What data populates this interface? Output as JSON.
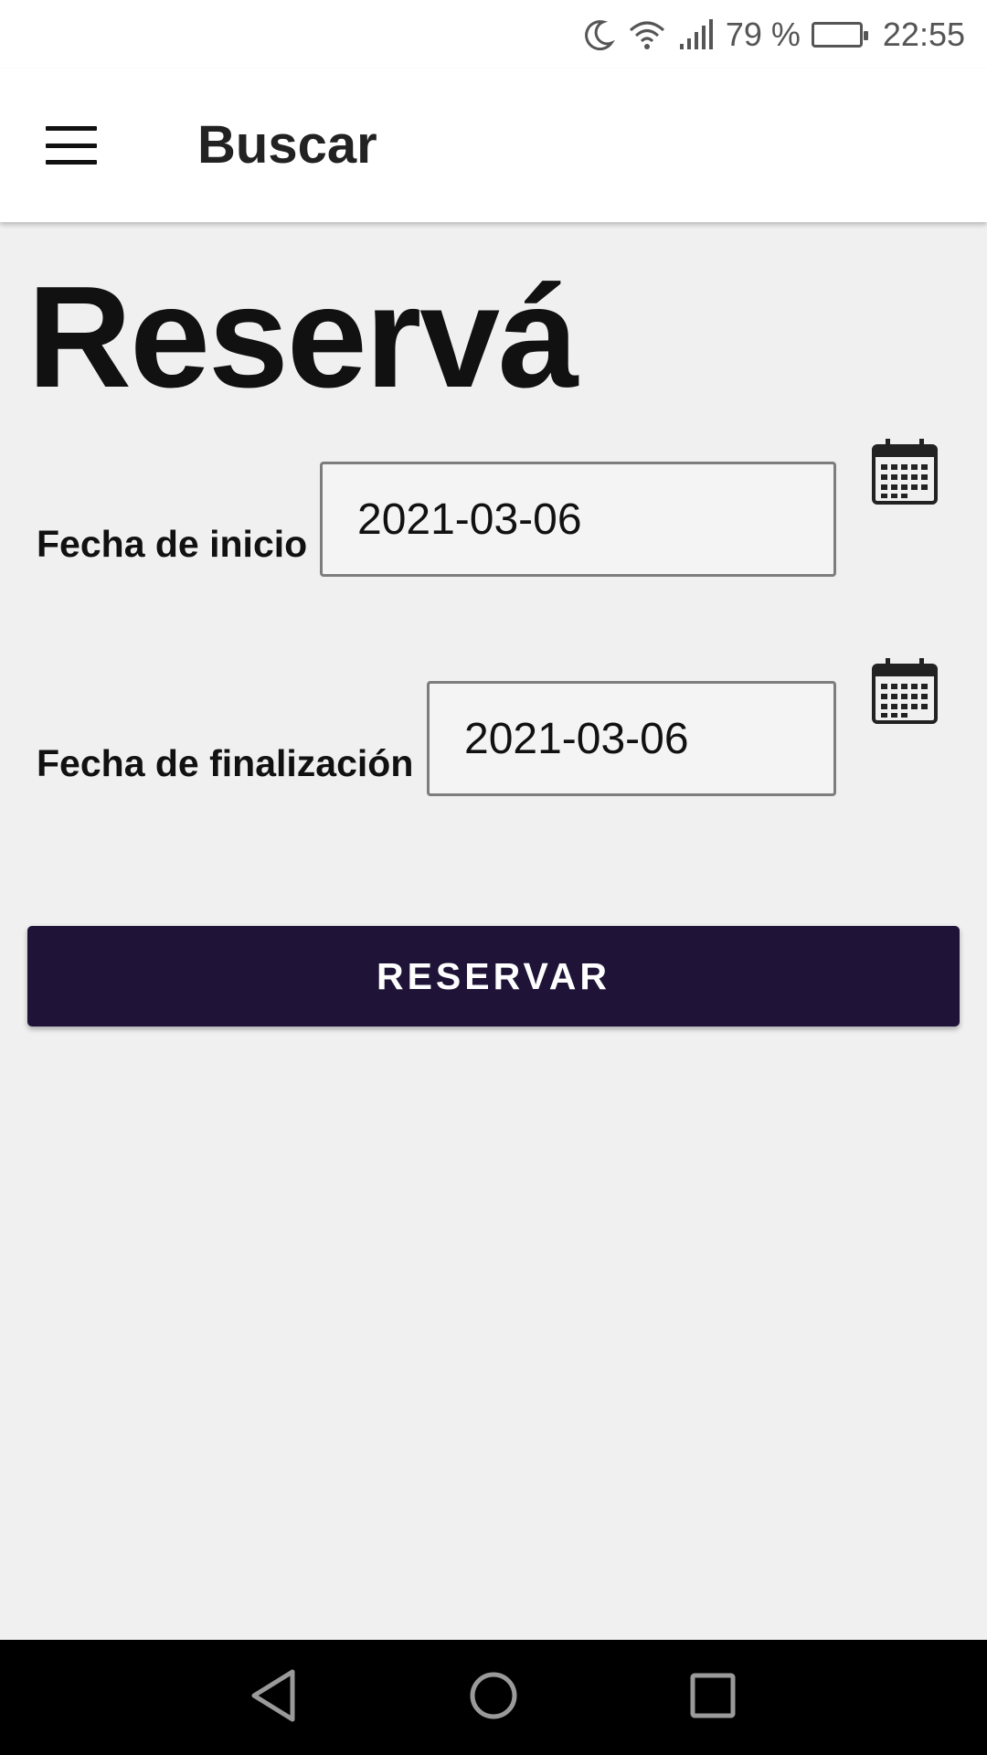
{
  "status_bar": {
    "battery_percent": "79 %",
    "time": "22:55",
    "icons": [
      "moon-icon",
      "wifi-icon",
      "signal-icon",
      "battery-icon"
    ]
  },
  "app_bar": {
    "title": "Buscar",
    "menu_icon": "hamburger-menu-icon"
  },
  "main": {
    "heading": "Reservá",
    "start_date": {
      "label": "Fecha de inicio",
      "value": "2021-03-06",
      "icon": "calendar-icon"
    },
    "end_date": {
      "label": "Fecha de finalización",
      "value": "2021-03-06",
      "icon": "calendar-icon"
    },
    "submit_label": "RESERVAR"
  },
  "colors": {
    "primary": "#1f1337",
    "background": "#f0f0f0",
    "app_bar": "#ffffff"
  },
  "nav_bar": {
    "icons": [
      "back-icon",
      "home-icon",
      "recents-icon"
    ]
  }
}
